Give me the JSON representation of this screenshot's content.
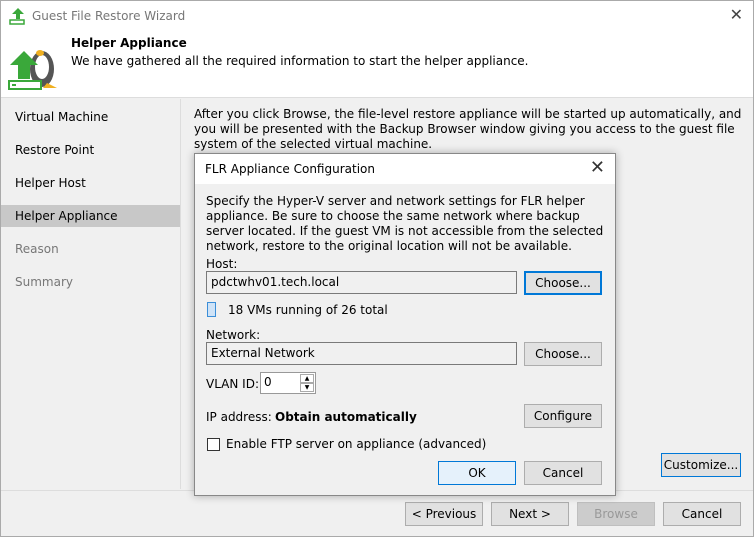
{
  "window": {
    "title": "Guest File Restore Wizard"
  },
  "header": {
    "title": "Helper Appliance",
    "subtitle": "We have gathered all the required information to start the helper appliance."
  },
  "nav": [
    {
      "label": "Virtual Machine"
    },
    {
      "label": "Restore Point"
    },
    {
      "label": "Helper Host"
    },
    {
      "label": "Helper Appliance"
    },
    {
      "label": "Reason"
    },
    {
      "label": "Summary"
    }
  ],
  "main": {
    "description": "After you click Browse, the file-level restore appliance will be started up automatically, and you will be presented with the Backup Browser window giving you access to the guest file system of the selected virtual machine.",
    "customize": "Customize..."
  },
  "footer": {
    "previous": "< Previous",
    "next": "Next >",
    "browse": "Browse",
    "cancel": "Cancel"
  },
  "dialog": {
    "title": "FLR Appliance Configuration",
    "intro": "Specify the Hyper-V server and network settings for FLR helper appliance. Be sure to choose the same network where backup server located. If the guest VM is not accessible from the selected network, restore to the original location will not be available.",
    "host_label": "Host:",
    "host_value": "pdctwhv01.tech.local",
    "choose": "Choose...",
    "vms_status": "18 VMs running of 26 total",
    "network_label": "Network:",
    "network_value": "External Network",
    "vlan_label": "VLAN ID:",
    "vlan_value": "0",
    "ip_label": "IP address:",
    "ip_value": "Obtain automatically",
    "configure": "Configure",
    "ftp_label": "Enable FTP server on appliance (advanced)",
    "ftp_checked": false,
    "ok": "OK",
    "cancel": "Cancel"
  }
}
